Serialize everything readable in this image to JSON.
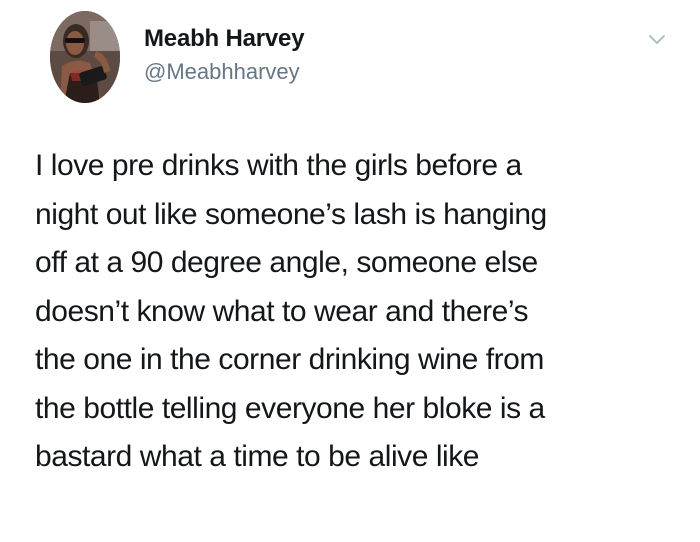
{
  "tweet": {
    "author": {
      "display_name": "Meabh Harvey",
      "handle": "@Meabhharvey",
      "avatar_icon": "profile-photo-avatar"
    },
    "menu_icon": "chevron-down-icon",
    "body_lines": [
      "I love pre drinks with the girls before a",
      "night out like someone’s lash is hanging",
      "off at a 90 degree angle, someone else",
      "doesn’t know what to wear and there’s",
      "the one in the corner drinking wine from",
      "the bottle telling everyone her bloke is a",
      "bastard what a time to be alive like"
    ]
  },
  "colors": {
    "background": "#ffffff",
    "text_primary": "#14171a",
    "text_secondary": "#657786",
    "caret": "#aab8c2"
  }
}
